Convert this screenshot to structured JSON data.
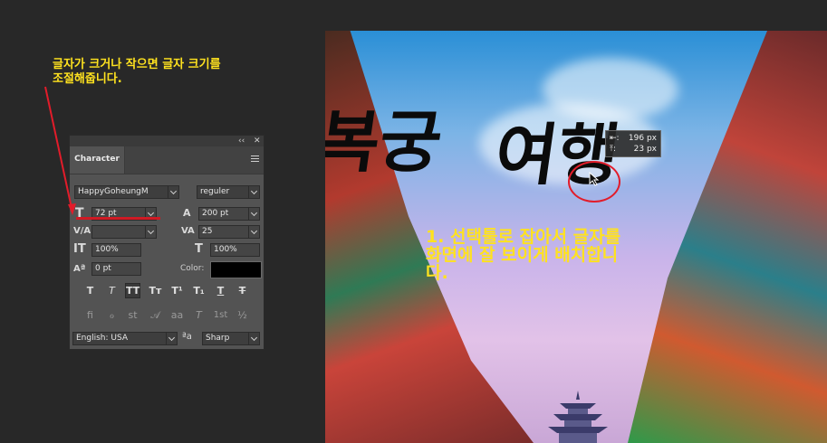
{
  "annotations": {
    "top_note": "글자가 크거나 작으면 글자 크기를\n조절해줍니다.",
    "canvas_note": "1. 선택툴로 잡아서 글자를\n화면에 잘 보이게 배치합니\n다."
  },
  "panel": {
    "collapse_glyph": "‹‹",
    "close_glyph": "✕",
    "tab_label": "Character",
    "font_family": "HappyGoheungM",
    "font_style": "reguler",
    "size_glyph": "T",
    "font_size": "72 pt",
    "leading_glyph": "A",
    "leading": "200 pt",
    "kerning_glyph": "V/A",
    "kerning": "",
    "tracking_glyph": "VA",
    "tracking": "25",
    "vscale_glyph": "IT",
    "vertical_scale": "100%",
    "hscale_glyph": "T",
    "horizontal_scale": "100%",
    "baseline_glyph": "Aª",
    "baseline_shift": "0 pt",
    "color_label": "Color:",
    "color_value": "#000000",
    "style_buttons": [
      "T",
      "T",
      "TT",
      "Tт",
      "T¹",
      "T₁",
      "T",
      "T"
    ],
    "opentype_buttons": [
      "fi",
      "ℴ",
      "st",
      "𝒜",
      "aa",
      "T",
      "1st",
      "½"
    ],
    "language": "English: USA",
    "aa_glyph": "ªa",
    "antialias": "Sharp"
  },
  "canvas": {
    "title_left": "복궁",
    "title_right": "여행",
    "tooltip_width": "196 px",
    "tooltip_height": "23 px"
  }
}
